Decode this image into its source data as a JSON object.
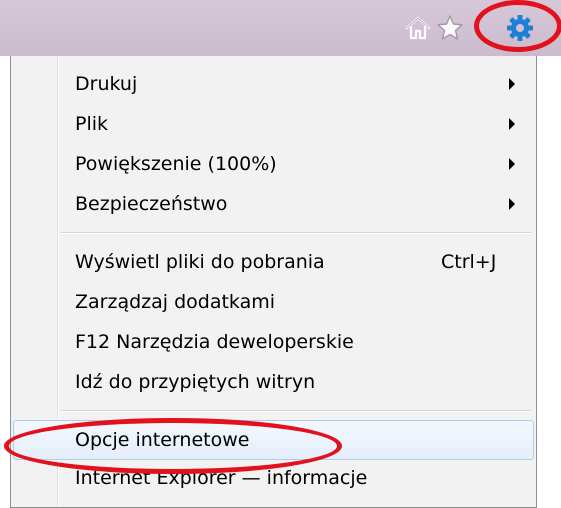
{
  "toolbar": {
    "icons": [
      "home-icon",
      "star-icon",
      "gear-icon"
    ],
    "background": "#cbbccd",
    "highlight_color": "#e3101d"
  },
  "menu": {
    "items": [
      {
        "label": "Drukuj",
        "submenu": true
      },
      {
        "label": "Plik",
        "submenu": true
      },
      {
        "label": "Powiększenie (100%)",
        "submenu": true
      },
      {
        "label": "Bezpieczeństwo",
        "submenu": true
      },
      {
        "label": "Wyświetl pliki do pobrania",
        "shortcut": "Ctrl+J"
      },
      {
        "label": "Zarządzaj dodatkami"
      },
      {
        "label": "F12 Narzędzia deweloperskie"
      },
      {
        "label": "Idź do przypiętych witryn"
      },
      {
        "label": "Opcje internetowe",
        "highlighted": true
      },
      {
        "label": "Internet Explorer — informacje"
      }
    ]
  }
}
